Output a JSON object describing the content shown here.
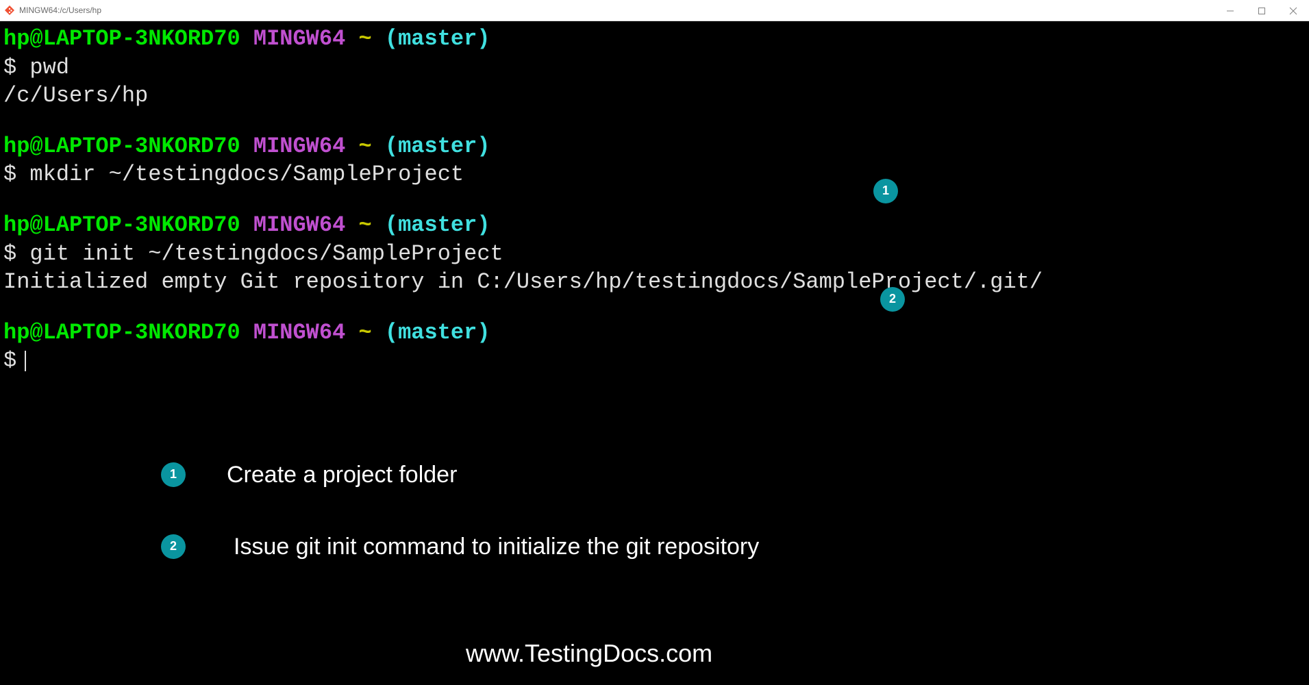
{
  "titlebar": {
    "title": "MINGW64:/c/Users/hp"
  },
  "prompt": {
    "user_host": "hp@LAPTOP-3NKORD70",
    "system": "MINGW64",
    "tilde": "~",
    "branch": "(master)",
    "symbol": "$"
  },
  "session": {
    "cmd1": "pwd",
    "out1": "/c/Users/hp",
    "cmd2": "mkdir ~/testingdocs/SampleProject",
    "cmd3": "git init ~/testingdocs/SampleProject",
    "out3": "Initialized empty Git repository in C:/Users/hp/testingdocs/SampleProject/.git/"
  },
  "callouts": {
    "b1": "1",
    "b2": "2"
  },
  "annotations": {
    "a1_num": "1",
    "a1_text": "Create a project folder",
    "a2_num": "2",
    "a2_text": "Issue git init command to initialize the git repository"
  },
  "footer": {
    "website": "www.TestingDocs.com"
  }
}
